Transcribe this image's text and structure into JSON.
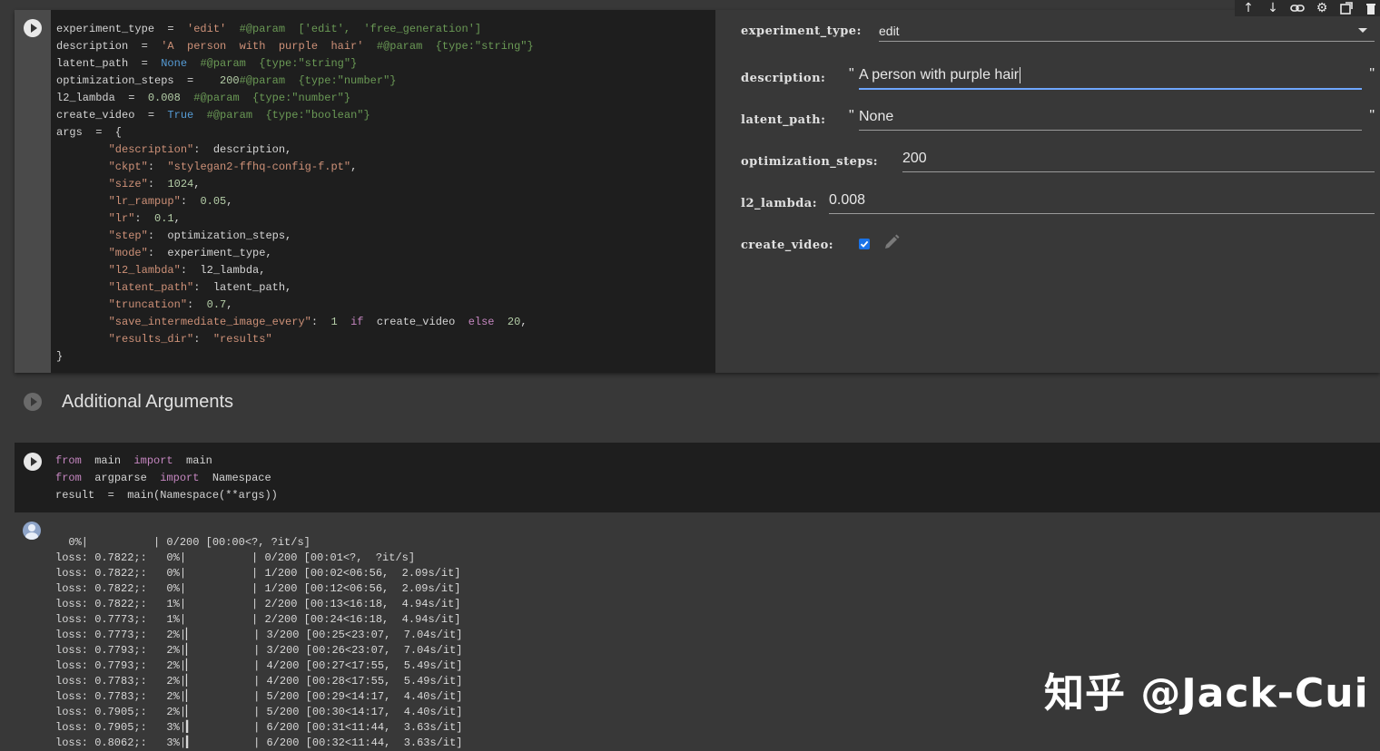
{
  "toolbar": {
    "icons": [
      "arrow-up-icon",
      "arrow-down-icon",
      "link-icon",
      "gear-icon",
      "open-in-new-icon",
      "trash-icon"
    ]
  },
  "cell1": {
    "code_lines": [
      [
        "experiment_type  =  ",
        {
          "t": "'edit'",
          "c": "str"
        },
        "  ",
        {
          "t": "#@param  ['edit',  'free_generation']",
          "c": "cm"
        }
      ],
      [
        "description  =  ",
        {
          "t": "'A  person  with  purple  hair'",
          "c": "str"
        },
        "  ",
        {
          "t": "#@param  {type:\"string\"}",
          "c": "cm"
        }
      ],
      [
        "latent_path  =  ",
        {
          "t": "None",
          "c": "kw"
        },
        "  ",
        {
          "t": "#@param  {type:\"string\"}",
          "c": "cm"
        }
      ],
      [
        "optimization_steps  =    ",
        {
          "t": "200",
          "c": "num"
        },
        {
          "t": "#@param  {type:\"number\"}",
          "c": "cm"
        }
      ],
      [
        "l2_lambda  =  ",
        {
          "t": "0.008",
          "c": "num"
        },
        "  ",
        {
          "t": "#@param  {type:\"number\"}",
          "c": "cm"
        }
      ],
      [
        "create_video  =  ",
        {
          "t": "True",
          "c": "kw"
        },
        "  ",
        {
          "t": "#@param  {type:\"boolean\"}",
          "c": "cm"
        }
      ],
      [
        "args  =  {"
      ],
      [
        "        ",
        {
          "t": "\"description\"",
          "c": "str"
        },
        ":  description,"
      ],
      [
        "        ",
        {
          "t": "\"ckpt\"",
          "c": "str"
        },
        ":  ",
        {
          "t": "\"stylegan2-ffhq-config-f.pt\"",
          "c": "str"
        },
        ","
      ],
      [
        "        ",
        {
          "t": "\"size\"",
          "c": "str"
        },
        ":  ",
        {
          "t": "1024",
          "c": "num"
        },
        ","
      ],
      [
        "        ",
        {
          "t": "\"lr_rampup\"",
          "c": "str"
        },
        ":  ",
        {
          "t": "0.05",
          "c": "num"
        },
        ","
      ],
      [
        "        ",
        {
          "t": "\"lr\"",
          "c": "str"
        },
        ":  ",
        {
          "t": "0.1",
          "c": "num"
        },
        ","
      ],
      [
        "        ",
        {
          "t": "\"step\"",
          "c": "str"
        },
        ":  optimization_steps,"
      ],
      [
        "        ",
        {
          "t": "\"mode\"",
          "c": "str"
        },
        ":  experiment_type,"
      ],
      [
        "        ",
        {
          "t": "\"l2_lambda\"",
          "c": "str"
        },
        ":  l2_lambda,"
      ],
      [
        "        ",
        {
          "t": "\"latent_path\"",
          "c": "str"
        },
        ":  latent_path,"
      ],
      [
        "        ",
        {
          "t": "\"truncation\"",
          "c": "str"
        },
        ":  ",
        {
          "t": "0.7",
          "c": "num"
        },
        ","
      ],
      [
        "        ",
        {
          "t": "\"save_intermediate_image_every\"",
          "c": "str"
        },
        ":  ",
        {
          "t": "1",
          "c": "num"
        },
        "  ",
        {
          "t": "if",
          "c": "pk"
        },
        "  create_video  ",
        {
          "t": "else",
          "c": "pk"
        },
        "  ",
        {
          "t": "20",
          "c": "num"
        },
        ","
      ],
      [
        "        ",
        {
          "t": "\"results_dir\"",
          "c": "str"
        },
        ":  ",
        {
          "t": "\"results\"",
          "c": "str"
        }
      ],
      [
        "}"
      ]
    ]
  },
  "form": {
    "experiment_type_label": "experiment_type:",
    "experiment_type_value": "edit",
    "description_label": "description:",
    "description_value": "A person with purple hair",
    "latent_path_label": "latent_path:",
    "latent_path_value": "None",
    "optimization_steps_label": "optimization_steps:",
    "optimization_steps_value": "200",
    "l2_lambda_label": "l2_lambda:",
    "l2_lambda_value": "0.008",
    "create_video_label": "create_video:",
    "quote": "\""
  },
  "section": {
    "title": "Additional Arguments"
  },
  "cell2": {
    "code_lines": [
      [
        {
          "t": "from",
          "c": "pk"
        },
        "  main  ",
        {
          "t": "import",
          "c": "pk"
        },
        "  main"
      ],
      [
        {
          "t": "from",
          "c": "pk"
        },
        "  argparse  ",
        {
          "t": "import",
          "c": "pk"
        },
        "  Namespace"
      ],
      [
        "result  =  main(Namespace(**args))"
      ]
    ]
  },
  "output": {
    "lines": [
      "  0%|          | 0/200 [00:00<?, ?it/s]",
      "loss: 0.7822;:   0%|          | 0/200 [00:01<?,  ?it/s]",
      "loss: 0.7822;:   0%|          | 1/200 [00:02<06:56,  2.09s/it]",
      "loss: 0.7822;:   0%|          | 1/200 [00:12<06:56,  2.09s/it]",
      "loss: 0.7822;:   1%|          | 2/200 [00:13<16:18,  4.94s/it]",
      "loss: 0.7773;:   1%|          | 2/200 [00:24<16:18,  4.94s/it]",
      "loss: 0.7773;:   2%|▏         | 3/200 [00:25<23:07,  7.04s/it]",
      "loss: 0.7793;:   2%|▏         | 3/200 [00:26<23:07,  7.04s/it]",
      "loss: 0.7793;:   2%|▏         | 4/200 [00:27<17:55,  5.49s/it]",
      "loss: 0.7783;:   2%|▏         | 4/200 [00:28<17:55,  5.49s/it]",
      "loss: 0.7783;:   2%|▏         | 5/200 [00:29<14:17,  4.40s/it]",
      "loss: 0.7905;:   2%|▏         | 5/200 [00:30<14:17,  4.40s/it]",
      "loss: 0.7905;:   3%|▎         | 6/200 [00:31<11:44,  3.63s/it]",
      "loss: 0.8062;:   3%|▎         | 6/200 [00:32<11:44,  3.63s/it]"
    ]
  },
  "watermark": "知乎 @Jack-Cui"
}
